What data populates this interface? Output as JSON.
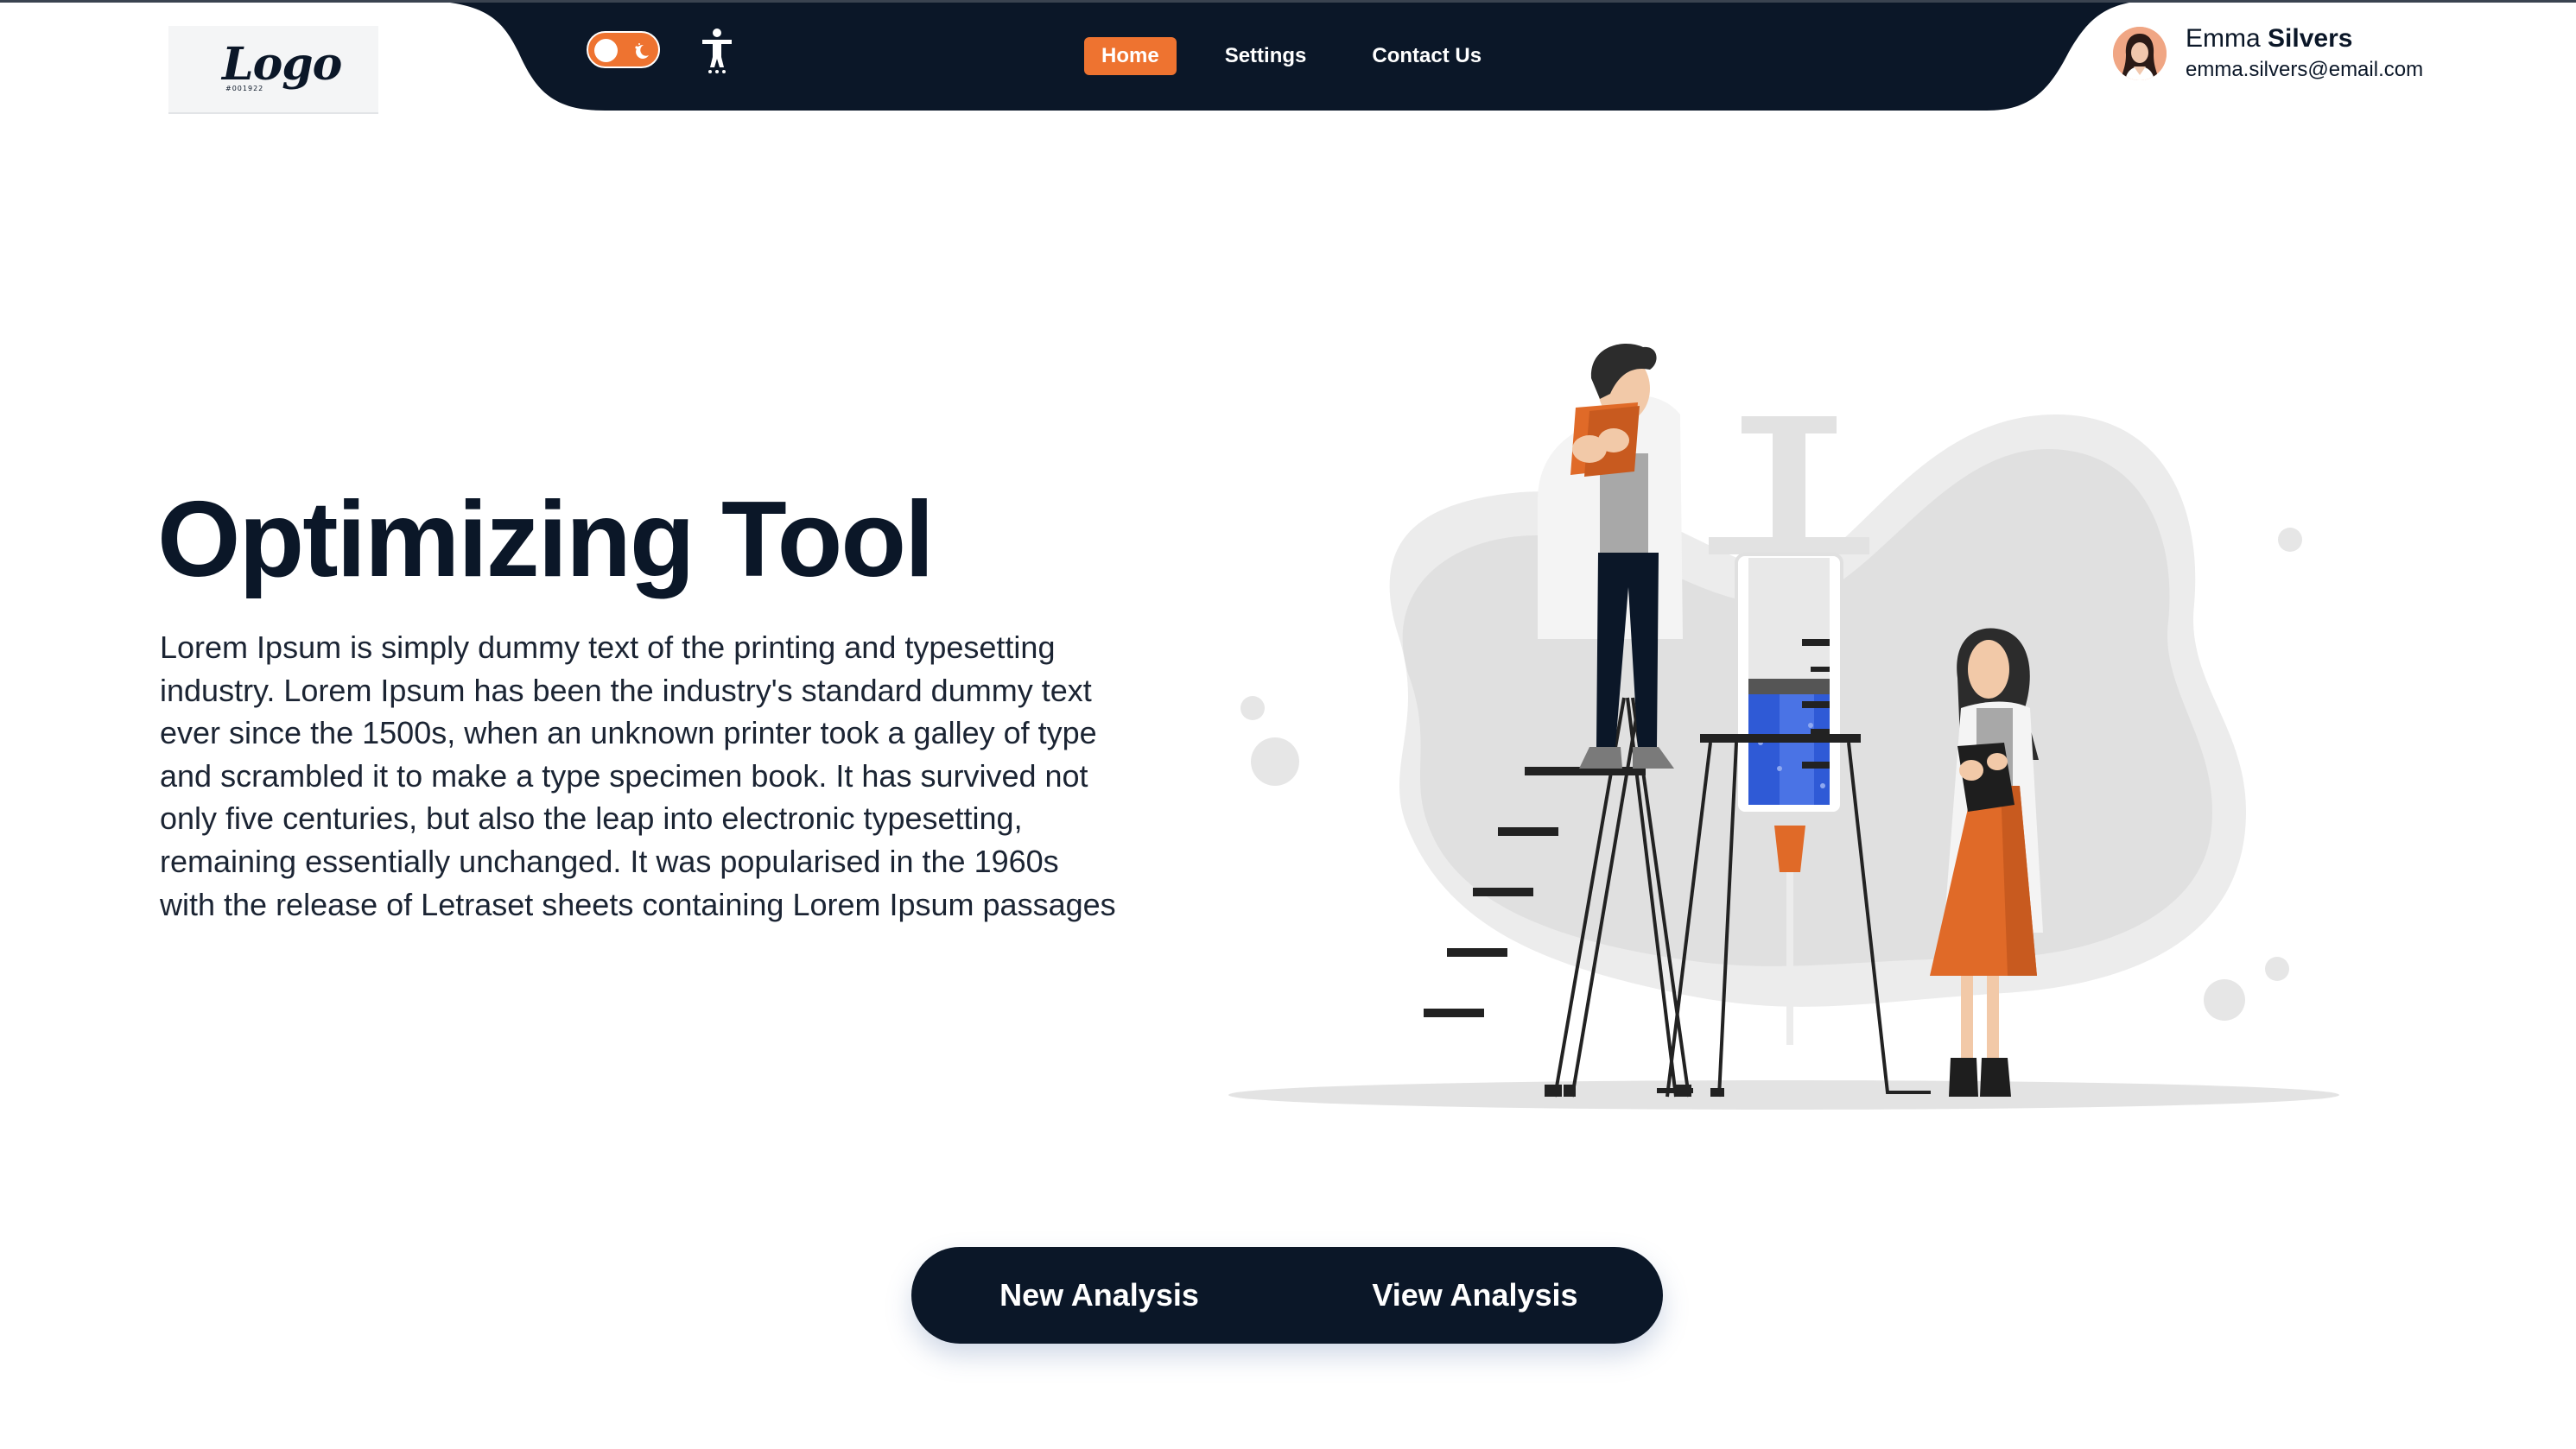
{
  "app": {
    "logo": {
      "text": "Logo",
      "subtext": "#001922"
    },
    "theme_toggle": {
      "state": "light",
      "icon": "moon-stars-icon"
    },
    "accessibility": {
      "icon": "accessibility-icon"
    }
  },
  "nav": {
    "items": [
      {
        "label": "Home",
        "active": true
      },
      {
        "label": "Settings",
        "active": false
      },
      {
        "label": "Contact Us",
        "active": false
      }
    ]
  },
  "user": {
    "first_name": "Emma",
    "last_name": "Silvers",
    "email": "emma.silvers@email.com"
  },
  "hero": {
    "title": "Optimizing Tool",
    "body": "Lorem Ipsum is simply dummy text of the printing and typesetting industry. Lorem Ipsum has been the industry's standard dummy text ever since the 1500s, when an unknown printer took a galley of type and scrambled it to make a type specimen book. It has survived not only five centuries, but also the leap into electronic typesetting, remaining essentially unchanged. It was popularised in the 1960s with the release of Letraset sheets containing Lorem Ipsum passages",
    "illustration": "scientists-syringe-illustration"
  },
  "actions": {
    "new_label": "New Analysis",
    "view_label": "View Analysis"
  },
  "colors": {
    "navy": "#0b1728",
    "accent": "#ee7330",
    "blob": "#ececec",
    "liquid": "#2f5ad6"
  }
}
